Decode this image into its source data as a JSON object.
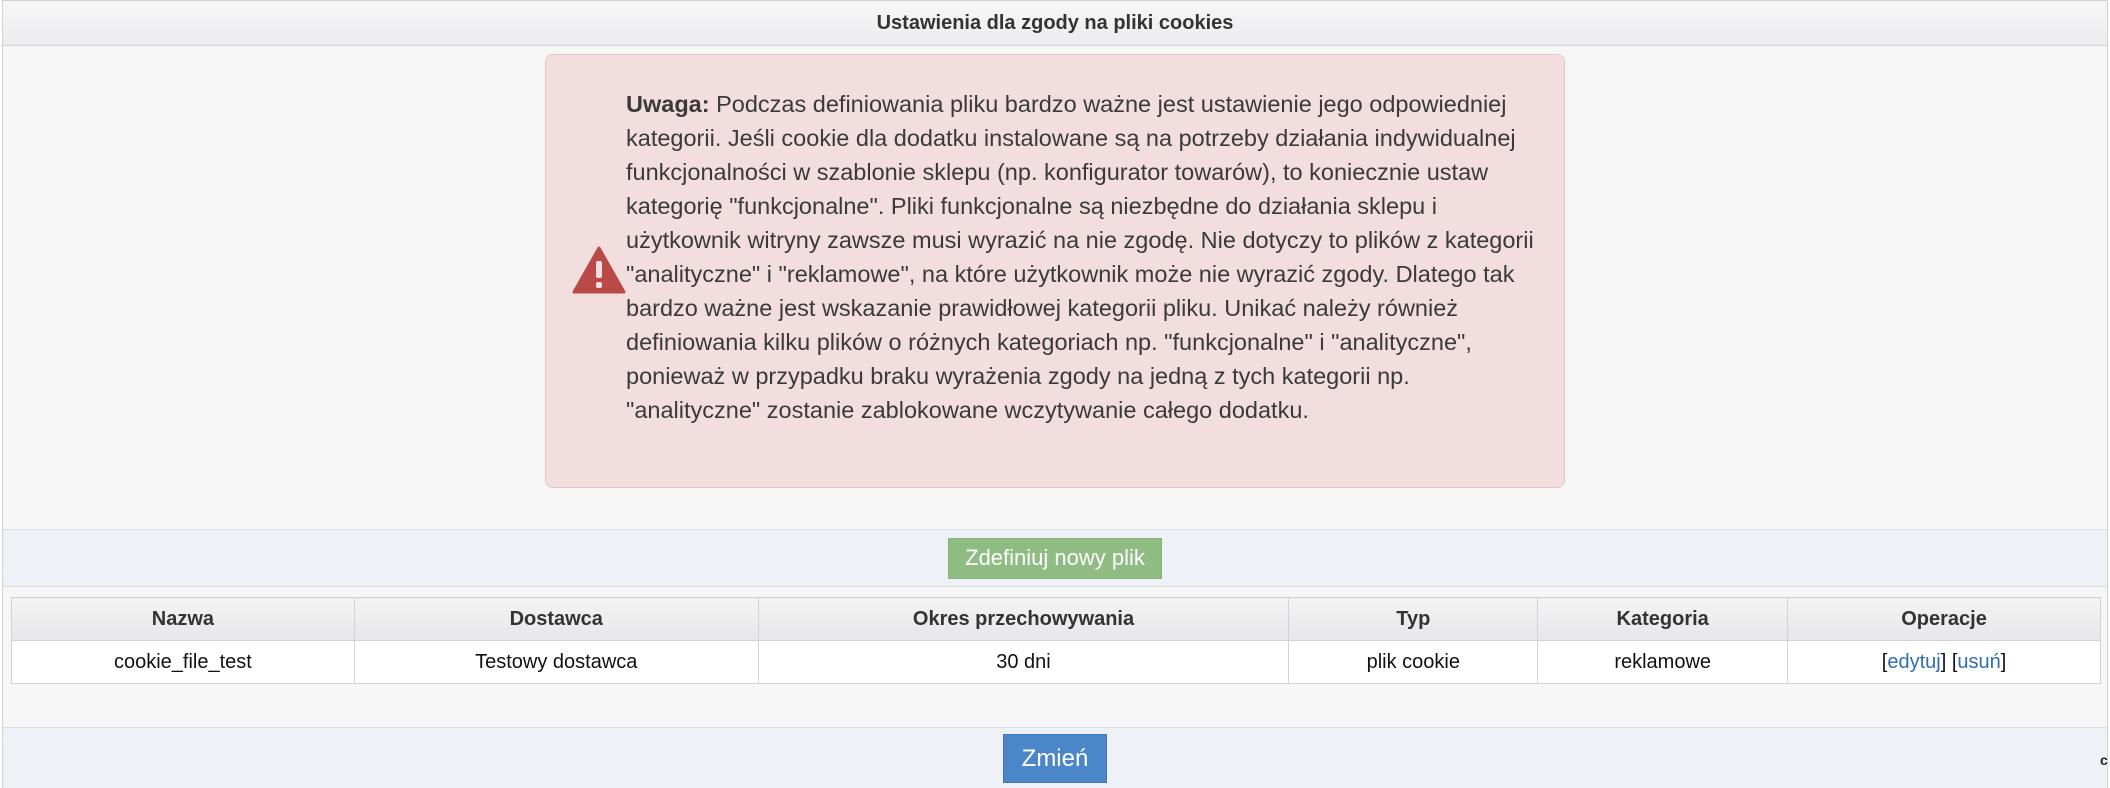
{
  "panel": {
    "title": "Ustawienia dla zgody na pliki cookies"
  },
  "alert": {
    "icon": "warning-triangle-icon",
    "bold": "Uwaga:",
    "text": " Podczas definiowania pliku bardzo ważne jest ustawienie jego odpowiedniej kategorii. Jeśli cookie dla dodatku instalowane są na potrzeby działania indywidualnej funkcjonalności w szablonie sklepu (np. konfigurator towarów), to koniecznie ustaw kategorię \"funkcjonalne\". Pliki funkcjonalne są niezbędne do działania sklepu i użytkownik witryny zawsze musi wyrazić na nie zgodę. Nie dotyczy to plików z kategorii \"analityczne\" i \"reklamowe\", na które użytkownik może nie wyrazić zgody. Dlatego tak bardzo ważne jest wskazanie prawidłowej kategorii pliku. Unikać należy również definiowania kilku plików o różnych kategoriach np. \"funkcjonalne\" i \"analityczne\", ponieważ w przypadku braku wyrażenia zgody na jedną z tych kategorii np. \"analityczne\" zostanie zablokowane wczytywanie całego dodatku.",
    "color": "#f2dede",
    "icon_color": "#b94a48"
  },
  "add_button": {
    "label": "Zdefiniuj nowy plik",
    "color": "#8fbc82"
  },
  "table": {
    "headers": [
      "Nazwa",
      "Dostawca",
      "Okres przechowywania",
      "Typ",
      "Kategoria",
      "Operacje"
    ],
    "rows": [
      {
        "name": "cookie_file_test",
        "provider": "Testowy dostawca",
        "retention": "30 dni",
        "type": "plik cookie",
        "category": "reklamowe",
        "ops": {
          "bracket_open": "[",
          "edit": "edytuj",
          "mid": "] [",
          "delete": "usuń",
          "bracket_close": "]"
        }
      }
    ]
  },
  "submit_button": {
    "label": "Zmień",
    "color": "#4a86c8"
  },
  "edge_text": "c"
}
